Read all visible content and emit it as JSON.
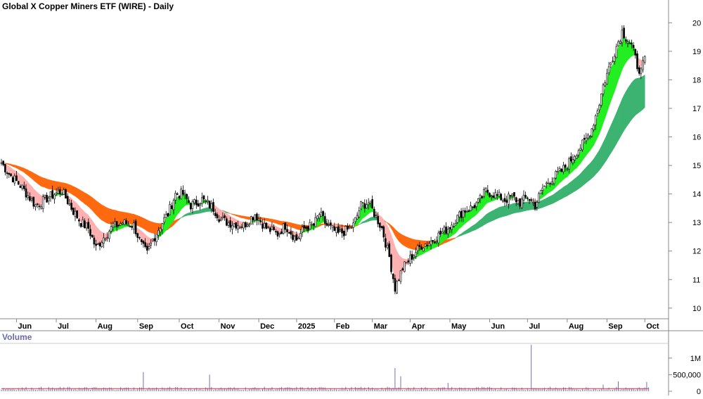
{
  "chart_data": {
    "type": "candlestick",
    "title": "Global X Copper Miners ETF (WIRE) - Daily",
    "volume_title": "Volume",
    "x_ticks": [
      "Jun",
      "Jul",
      "Aug",
      "Sep",
      "Oct",
      "Nov",
      "Dec",
      "2025",
      "Feb",
      "Mar",
      "Apr",
      "May",
      "Jun",
      "Jul",
      "Aug",
      "Sep",
      "Oct"
    ],
    "y_ticks": [
      10,
      11,
      12,
      13,
      14,
      15,
      16,
      17,
      18,
      19,
      20
    ],
    "ylim": [
      9.7,
      20.6
    ],
    "volume_ticks": [
      {
        "value": 0,
        "label": "0"
      },
      {
        "value": 500000,
        "label": "500,000"
      },
      {
        "value": 1000000,
        "label": "1M"
      }
    ],
    "volume_ylim": [
      0,
      1400000
    ],
    "price_path": [
      [
        0,
        15.1
      ],
      [
        4,
        14.7
      ],
      [
        10,
        14.3
      ],
      [
        18,
        13.6
      ],
      [
        28,
        14.0
      ],
      [
        32,
        14.1
      ],
      [
        38,
        13.4
      ],
      [
        42,
        13.0
      ],
      [
        46,
        12.8
      ],
      [
        50,
        12.1
      ],
      [
        53,
        12.4
      ],
      [
        58,
        12.8
      ],
      [
        64,
        13.0
      ],
      [
        70,
        12.9
      ],
      [
        74,
        12.2
      ],
      [
        77,
        11.9
      ],
      [
        80,
        12.4
      ],
      [
        84,
        12.9
      ],
      [
        88,
        13.3
      ],
      [
        92,
        14.0
      ],
      [
        96,
        14.0
      ],
      [
        100,
        13.6
      ],
      [
        106,
        13.8
      ],
      [
        112,
        13.5
      ],
      [
        116,
        13.1
      ],
      [
        120,
        13.0
      ],
      [
        128,
        12.9
      ],
      [
        134,
        13.3
      ],
      [
        140,
        12.8
      ],
      [
        146,
        12.6
      ],
      [
        150,
        12.9
      ],
      [
        156,
        12.4
      ],
      [
        160,
        12.8
      ],
      [
        165,
        12.9
      ],
      [
        168,
        13.3
      ],
      [
        172,
        12.9
      ],
      [
        178,
        12.6
      ],
      [
        182,
        12.7
      ],
      [
        186,
        12.9
      ],
      [
        190,
        13.6
      ],
      [
        194,
        13.7
      ],
      [
        198,
        13.2
      ],
      [
        201,
        12.8
      ],
      [
        205,
        11.8
      ],
      [
        208,
        10.7
      ],
      [
        212,
        11.4
      ],
      [
        218,
        11.9
      ],
      [
        222,
        12.2
      ],
      [
        226,
        12.3
      ],
      [
        230,
        12.5
      ],
      [
        236,
        12.8
      ],
      [
        240,
        13.1
      ],
      [
        244,
        13.4
      ],
      [
        248,
        13.5
      ],
      [
        252,
        13.7
      ],
      [
        256,
        14.1
      ],
      [
        260,
        14.0
      ],
      [
        266,
        13.8
      ],
      [
        270,
        13.9
      ],
      [
        274,
        13.7
      ],
      [
        278,
        13.9
      ],
      [
        282,
        13.6
      ],
      [
        286,
        14.2
      ],
      [
        290,
        14.5
      ],
      [
        296,
        14.8
      ],
      [
        300,
        15.1
      ],
      [
        304,
        15.5
      ],
      [
        308,
        15.8
      ],
      [
        312,
        16.3
      ],
      [
        316,
        17.2
      ],
      [
        318,
        17.8
      ],
      [
        322,
        18.6
      ],
      [
        324,
        19.0
      ],
      [
        328,
        19.7
      ],
      [
        330,
        19.5
      ],
      [
        333,
        19.2
      ],
      [
        336,
        18.5
      ],
      [
        338,
        18.3
      ],
      [
        340,
        18.7
      ]
    ],
    "last_bar": 340,
    "bar_span": [
      0,
      344
    ],
    "month_positions": [
      8,
      29,
      50,
      72,
      94,
      115,
      136,
      156,
      176,
      196,
      216,
      237,
      258,
      278,
      299,
      320,
      340
    ],
    "volume_avg": 80000,
    "volume_spikes": [
      {
        "bar": 75,
        "value": 580000
      },
      {
        "bar": 110,
        "value": 500000
      },
      {
        "bar": 208,
        "value": 700000
      },
      {
        "bar": 211,
        "value": 450000
      },
      {
        "bar": 236,
        "value": 250000
      },
      {
        "bar": 280,
        "value": 1400000
      },
      {
        "bar": 318,
        "value": 200000
      },
      {
        "bar": 326,
        "value": 300000
      },
      {
        "bar": 341,
        "value": 280000
      }
    ],
    "colors": {
      "short_ma_up": "#22ee22",
      "short_ma_down": "#ffb0b0",
      "long_ma_up": "#3cb371",
      "long_ma_down": "#ff6a10",
      "candle": "#000000",
      "volume_bar": "#7070bb",
      "volume_avg_line": "#e03030",
      "volume_title": "#6a6aaa",
      "axis": "#888888"
    }
  }
}
